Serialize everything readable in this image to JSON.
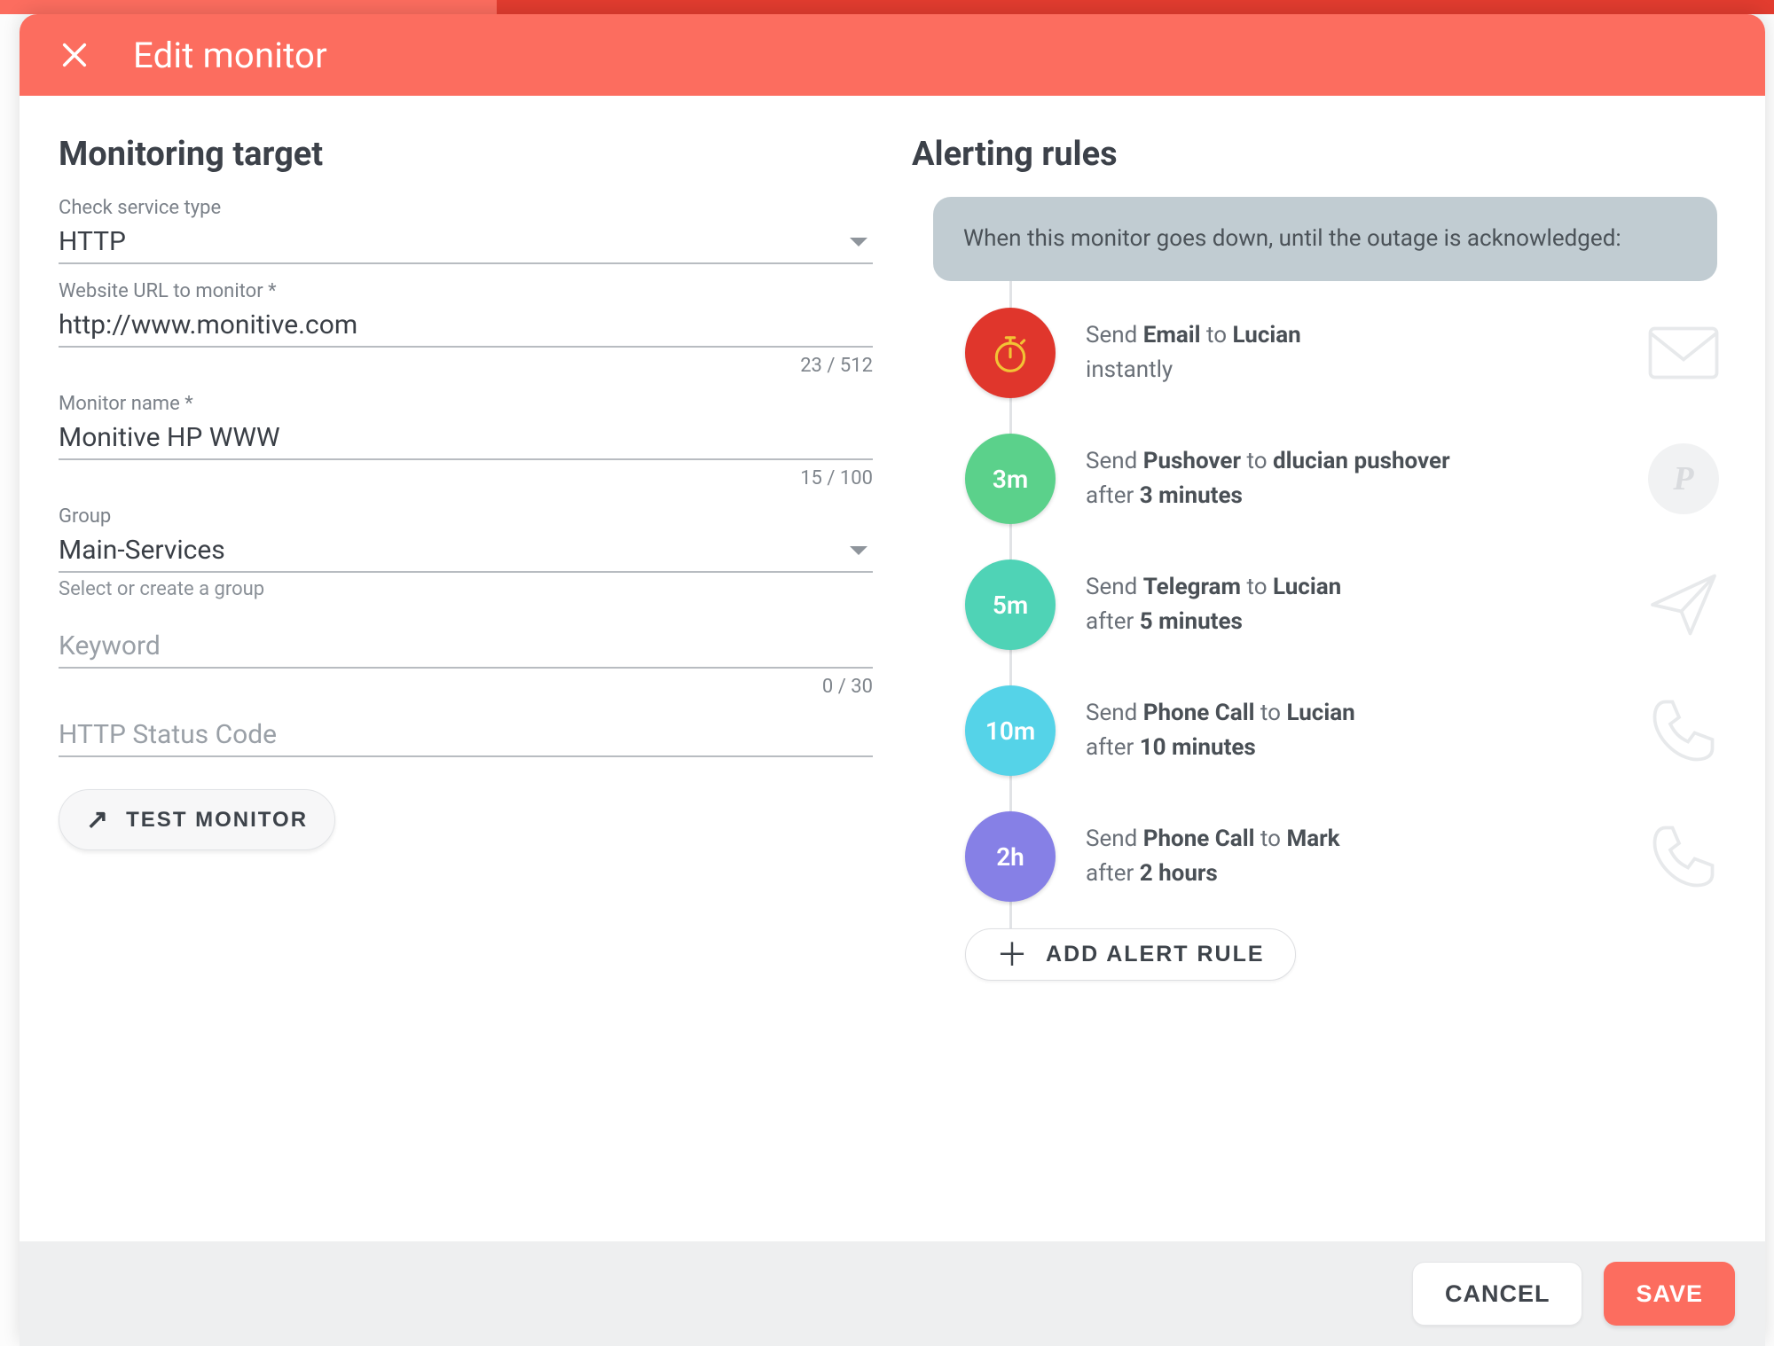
{
  "header": {
    "title": "Edit monitor"
  },
  "left": {
    "title": "Monitoring target",
    "fields": {
      "service_type": {
        "label": "Check service type",
        "value": "HTTP"
      },
      "url": {
        "label": "Website URL to monitor *",
        "value": "http://www.monitive.com",
        "counter": "23 / 512"
      },
      "name": {
        "label": "Monitor name *",
        "value": "Monitive HP WWW",
        "counter": "15 / 100"
      },
      "group": {
        "label": "Group",
        "value": "Main-Services",
        "helper": "Select or create a group"
      },
      "keyword": {
        "placeholder": "Keyword",
        "value": "",
        "counter": "0 / 30"
      },
      "status_code": {
        "placeholder": "HTTP Status Code",
        "value": ""
      }
    },
    "test_button": "TEST MONITOR"
  },
  "right": {
    "title": "Alerting rules",
    "info": "When this monitor goes down, until the outage is acknowledged:",
    "rules": [
      {
        "delay_short": "",
        "badge_icon": "stopwatch",
        "color": "A",
        "prefix": "Send ",
        "channel": "Email",
        "mid": " to ",
        "target": "Lucian",
        "after_prefix": "",
        "after_value": "instantly",
        "after_is_strong": false,
        "icon": "mail"
      },
      {
        "delay_short": "3m",
        "badge_icon": "",
        "color": "B",
        "prefix": "Send ",
        "channel": "Pushover",
        "mid": " to ",
        "target": "dlucian pushover",
        "after_prefix": "after ",
        "after_value": "3 minutes",
        "after_is_strong": true,
        "icon": "pushover"
      },
      {
        "delay_short": "5m",
        "badge_icon": "",
        "color": "C",
        "prefix": "Send ",
        "channel": "Telegram",
        "mid": " to ",
        "target": "Lucian",
        "after_prefix": "after ",
        "after_value": "5 minutes",
        "after_is_strong": true,
        "icon": "paperplane"
      },
      {
        "delay_short": "10m",
        "badge_icon": "",
        "color": "D",
        "prefix": "Send ",
        "channel": "Phone Call",
        "mid": " to ",
        "target": "Lucian",
        "after_prefix": "after ",
        "after_value": "10 minutes",
        "after_is_strong": true,
        "icon": "phone"
      },
      {
        "delay_short": "2h",
        "badge_icon": "",
        "color": "E",
        "prefix": "Send ",
        "channel": "Phone Call",
        "mid": " to ",
        "target": "Mark",
        "after_prefix": "after ",
        "after_value": "2 hours",
        "after_is_strong": true,
        "icon": "phone"
      }
    ],
    "add_button": "ADD ALERT RULE"
  },
  "footer": {
    "cancel": "CANCEL",
    "save": "SAVE"
  }
}
